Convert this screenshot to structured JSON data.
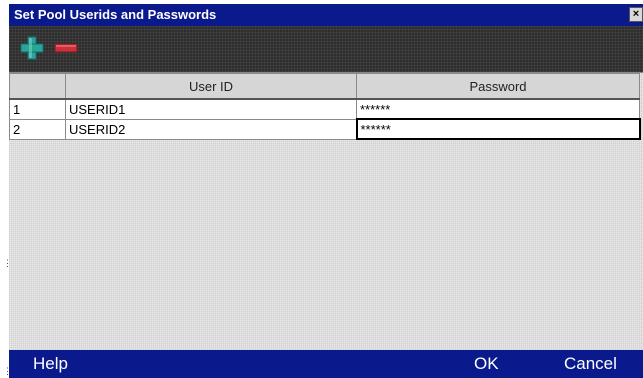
{
  "window": {
    "title": "Set Pool Userids and Passwords",
    "close_label": "×"
  },
  "toolbar": {
    "add_icon": "plus-icon",
    "remove_icon": "minus-icon"
  },
  "table": {
    "columns": [
      "",
      "User ID",
      "Password"
    ],
    "rows": [
      {
        "index": "1",
        "user_id": "USERID1",
        "password": "******"
      },
      {
        "index": "2",
        "user_id": "USERID2",
        "password": "******"
      }
    ]
  },
  "footer": {
    "help_label": "Help",
    "ok_label": "OK",
    "cancel_label": "Cancel"
  },
  "colors": {
    "title_bar": "#0a1a8c",
    "add_icon": "#2aa59a",
    "remove_icon": "#c8323a"
  }
}
